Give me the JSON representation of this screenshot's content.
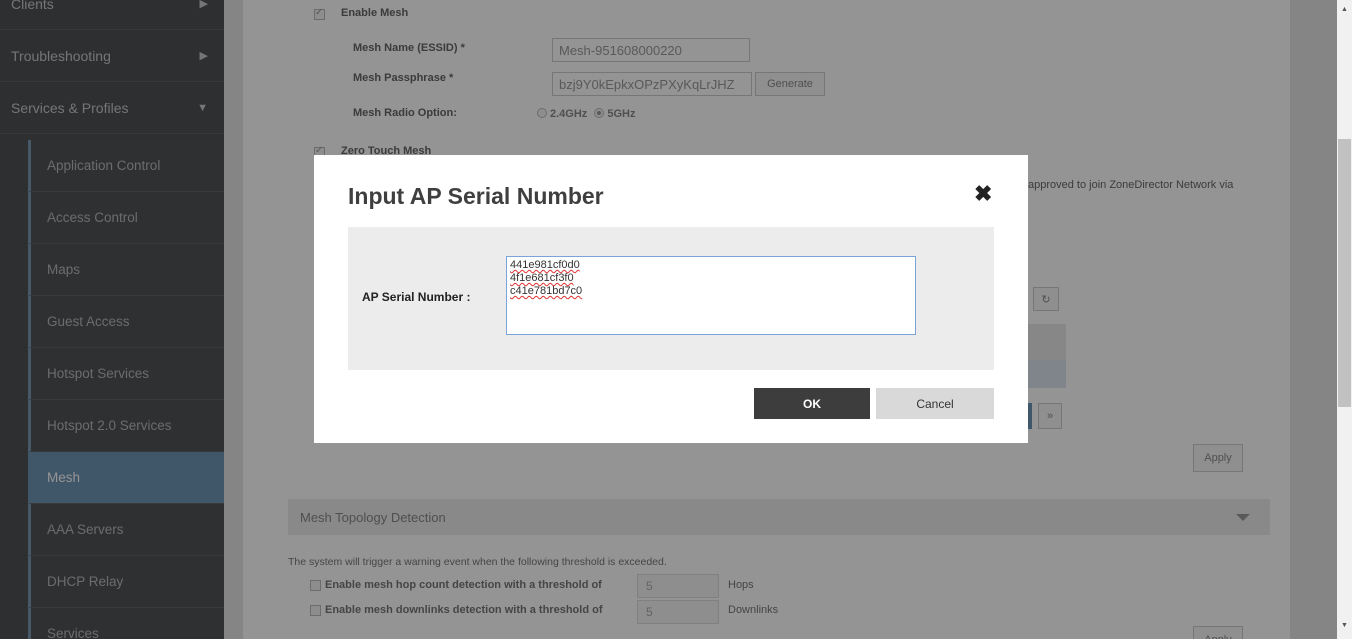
{
  "sidebar": {
    "top_items": [
      {
        "label": "Clients",
        "arrow": "▶"
      },
      {
        "label": "Troubleshooting",
        "arrow": "▶"
      },
      {
        "label": "Services & Profiles",
        "arrow": "▼"
      }
    ],
    "sub_items": [
      {
        "label": "Application Control"
      },
      {
        "label": "Access Control"
      },
      {
        "label": "Maps"
      },
      {
        "label": "Guest Access"
      },
      {
        "label": "Hotspot Services"
      },
      {
        "label": "Hotspot 2.0 Services"
      },
      {
        "label": "Mesh",
        "active": true
      },
      {
        "label": "AAA Servers"
      },
      {
        "label": "DHCP Relay"
      },
      {
        "label": "Services"
      }
    ]
  },
  "mesh_settings": {
    "enable_mesh_label": "Enable Mesh",
    "mesh_name_label": "Mesh Name (ESSID) *",
    "mesh_name_value": "Mesh-951608000220",
    "mesh_passphrase_label": "Mesh Passphrase *",
    "mesh_passphrase_value": "bzj9Y0kEpkxOPzPXyKqLrJHZ",
    "generate_label": "Generate",
    "radio_option_label": "Mesh Radio Option:",
    "radio_24": "2.4GHz",
    "radio_5": "5GHz",
    "zero_touch_label": "Zero Touch Mesh",
    "zero_touch_desc_fragment": "approved to join ZoneDirector Network via",
    "apply_label": "Apply"
  },
  "topology": {
    "header": "Mesh Topology Detection",
    "description": "The system will trigger a warning event when the following threshold is exceeded.",
    "hop_label": "Enable mesh hop count detection with a threshold of",
    "hop_value": "5",
    "hop_unit": "Hops",
    "downlinks_label": "Enable mesh downlinks detection with a threshold of",
    "downlinks_value": "5",
    "downlinks_unit": "Downlinks",
    "apply_label": "Apply"
  },
  "modal": {
    "title": "Input AP Serial Number",
    "close_glyph": "✖",
    "serial_label": "AP Serial Number :",
    "serial_value": "441e981cf0d0\n4f1e681cf3f0\nc41e781bd7c0",
    "ok_label": "OK",
    "cancel_label": "Cancel"
  },
  "colors": {
    "sidebar_bg": "#4e5254",
    "active_item": "#6f95b6",
    "ok_button": "#3d3d3d"
  }
}
